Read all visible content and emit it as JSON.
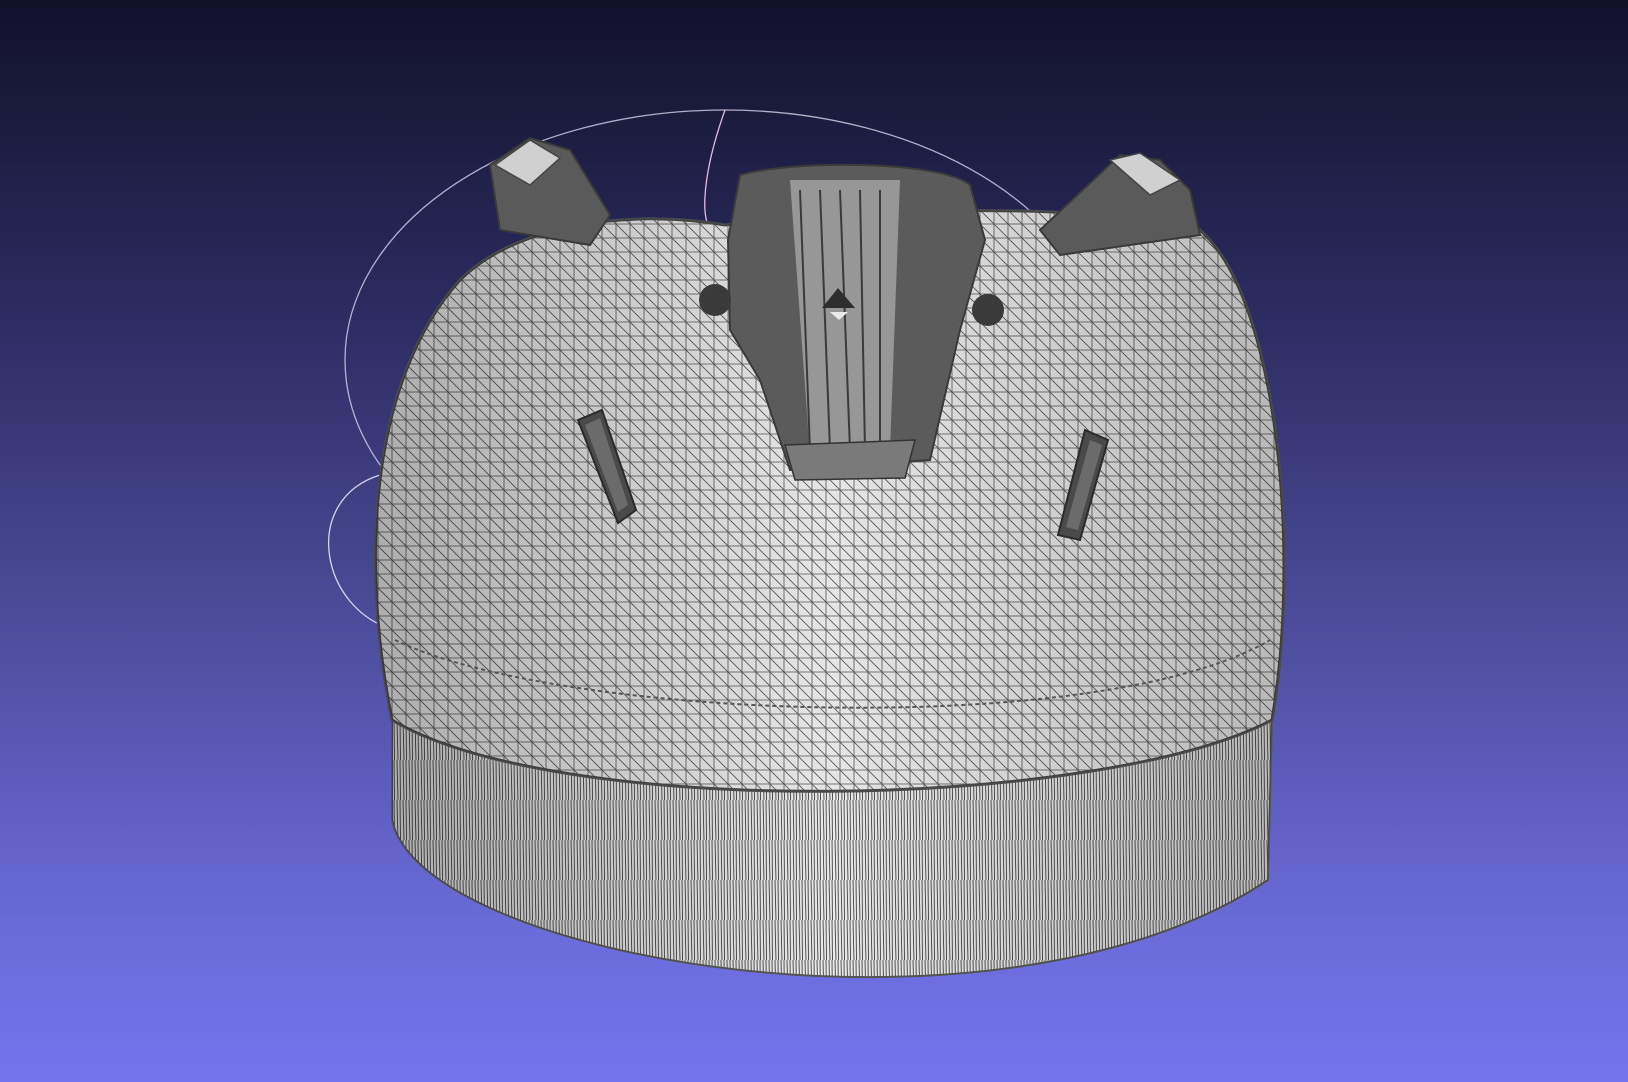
{
  "viewer": {
    "background_top": "#11112a",
    "background_bottom": "#7474ee",
    "mesh_fill": "#e4e4e4",
    "mesh_edge": "#4a4a4a",
    "trackball_color": "#cfcfe8",
    "mode": "wireframe-overlay"
  },
  "model": {
    "shape": "domed-cylinder-cap",
    "features": [
      "front-handle-slot",
      "left-slot",
      "right-slot",
      "left-corner-post",
      "right-corner-post"
    ]
  }
}
